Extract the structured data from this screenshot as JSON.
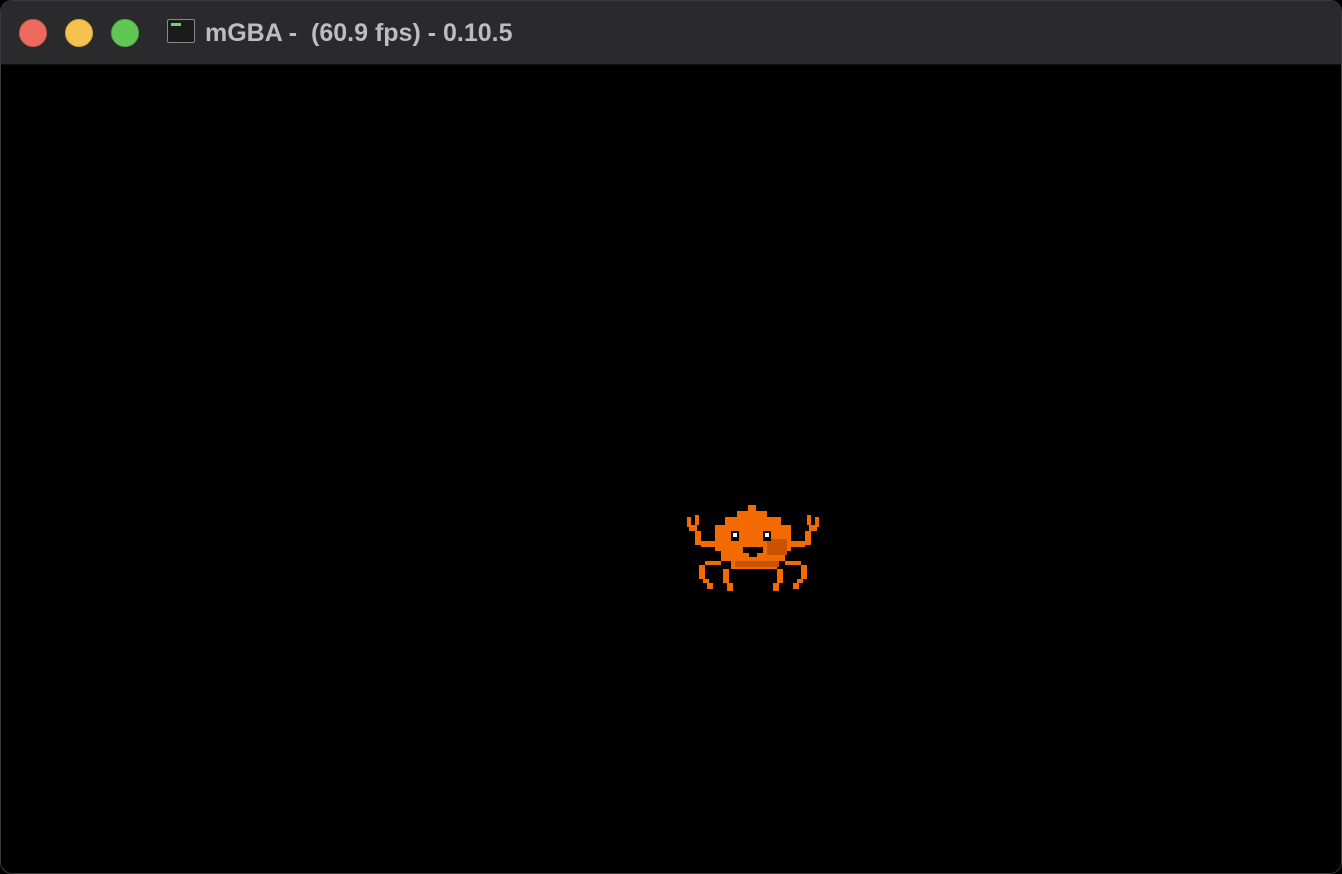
{
  "window": {
    "title": "mGBA -  (60.9 fps) - 0.10.5",
    "controls": {
      "close": "close-icon",
      "minimize": "minimize-icon",
      "zoom": "zoom-icon"
    },
    "app_icon": "terminal-icon"
  },
  "game": {
    "background_color": "#000000",
    "sprite": {
      "name": "crab-sprite",
      "color_primary": "#f26a00",
      "color_shadow": "#c95300"
    }
  }
}
